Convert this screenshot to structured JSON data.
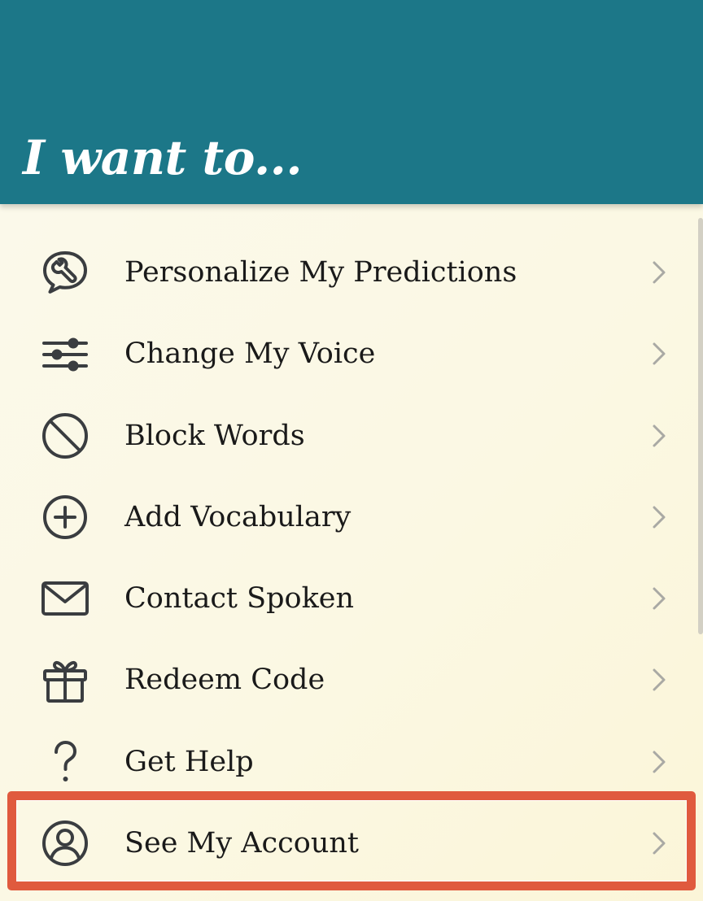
{
  "header": {
    "title": "I want to..."
  },
  "colors": {
    "header_bg": "#1c7788",
    "highlight": "#e05a3e",
    "icon": "#3a3d40",
    "chevron": "#a9a9a4"
  },
  "menu": {
    "items": [
      {
        "label": "Personalize My Predictions",
        "icon": "wrench-speech-icon"
      },
      {
        "label": "Change My Voice",
        "icon": "sliders-icon"
      },
      {
        "label": "Block Words",
        "icon": "block-icon"
      },
      {
        "label": "Add Vocabulary",
        "icon": "plus-circle-icon"
      },
      {
        "label": "Contact Spoken",
        "icon": "envelope-icon"
      },
      {
        "label": "Redeem Code",
        "icon": "gift-icon"
      },
      {
        "label": "Get Help",
        "icon": "question-icon"
      },
      {
        "label": "See My Account",
        "icon": "account-icon",
        "highlighted": true
      }
    ]
  }
}
